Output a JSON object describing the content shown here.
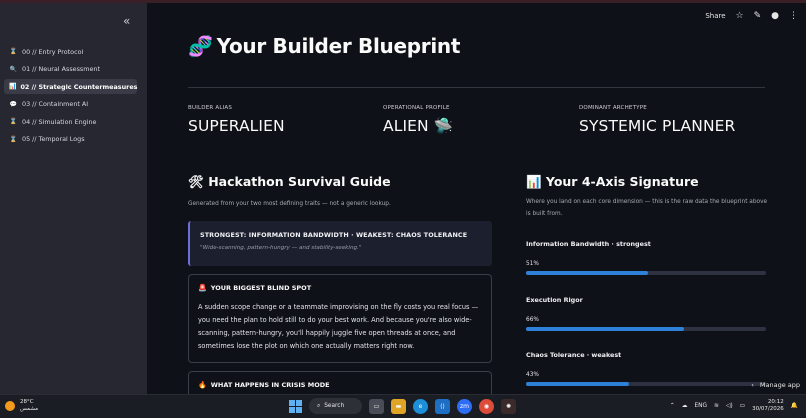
{
  "sidebar": {
    "collapse_glyph": "«",
    "items": [
      {
        "icon": "⌛",
        "label": "00 // Entry Protocol",
        "active": false
      },
      {
        "icon": "🔍",
        "label": "01 // Neural Assessment",
        "active": false
      },
      {
        "icon": "📊",
        "label": "02 // Strategic Countermeasures",
        "active": true
      },
      {
        "icon": "💬",
        "label": "03 // Containment AI",
        "active": false
      },
      {
        "icon": "⌛",
        "label": "04 // Simulation Engine",
        "active": false
      },
      {
        "icon": "⌛",
        "label": "05 // Temporal Logs",
        "active": false
      }
    ]
  },
  "topbar": {
    "share_label": "Share"
  },
  "page": {
    "title_emoji": "🧬",
    "title": "Your Builder Blueprint"
  },
  "profile": {
    "alias_label": "BUILDER ALIAS",
    "alias_value": "SUPERALIEN",
    "operational_label": "OPERATIONAL PROFILE",
    "operational_value": "ALIEN 🛸",
    "archetype_label": "DOMINANT ARCHETYPE",
    "archetype_value": "SYSTEMIC PLANNER"
  },
  "guide": {
    "title": "🛠 Hackathon Survival Guide",
    "subtitle": "Generated from your two most defining traits — not a generic lookup.",
    "callout_heading": "STRONGEST: INFORMATION BANDWIDTH · WEAKEST: CHAOS TOLERANCE",
    "callout_sub": "\"Wide-scanning, pattern-hungry — and stability-seeking.\"",
    "blind_spot_icon": "🚨",
    "blind_spot_heading": "YOUR BIGGEST BLIND SPOT",
    "blind_spot_body": "A sudden scope change or a teammate improvising on the fly costs you real focus — you need the plan to hold still to do your best work. And because you're also wide-scanning, pattern-hungry, you'll happily juggle five open threads at once, and sometimes lose the plot on which one actually matters right now.",
    "crisis_icon": "🔥",
    "crisis_heading": "WHAT HAPPENS IN CRISIS MODE"
  },
  "signature": {
    "title": "📊 Your 4-Axis Signature",
    "subtitle": "Where you land on each core dimension — this is the raw data the blueprint above is built from.",
    "metrics": [
      {
        "label": "Information Bandwidth · strongest",
        "value_text": "51%",
        "value": 0.51
      },
      {
        "label": "Execution Rigor",
        "value_text": "66%",
        "value": 0.66
      },
      {
        "label": "Chaos Tolerance · weakest",
        "value_text": "43%",
        "value": 0.43
      }
    ]
  },
  "manage_app": {
    "label": "Manage app",
    "chevron": "‹"
  },
  "taskbar": {
    "temp": "28°C",
    "weather_text": "مشمس",
    "search_label": "Search",
    "lang": "ENG",
    "time": "20:12",
    "date": "30/07/2026"
  },
  "colors": {
    "background": "#0e1117",
    "sidebar": "#262730",
    "progress": "#2f80d8",
    "callout_border": "#6c6fd9"
  }
}
